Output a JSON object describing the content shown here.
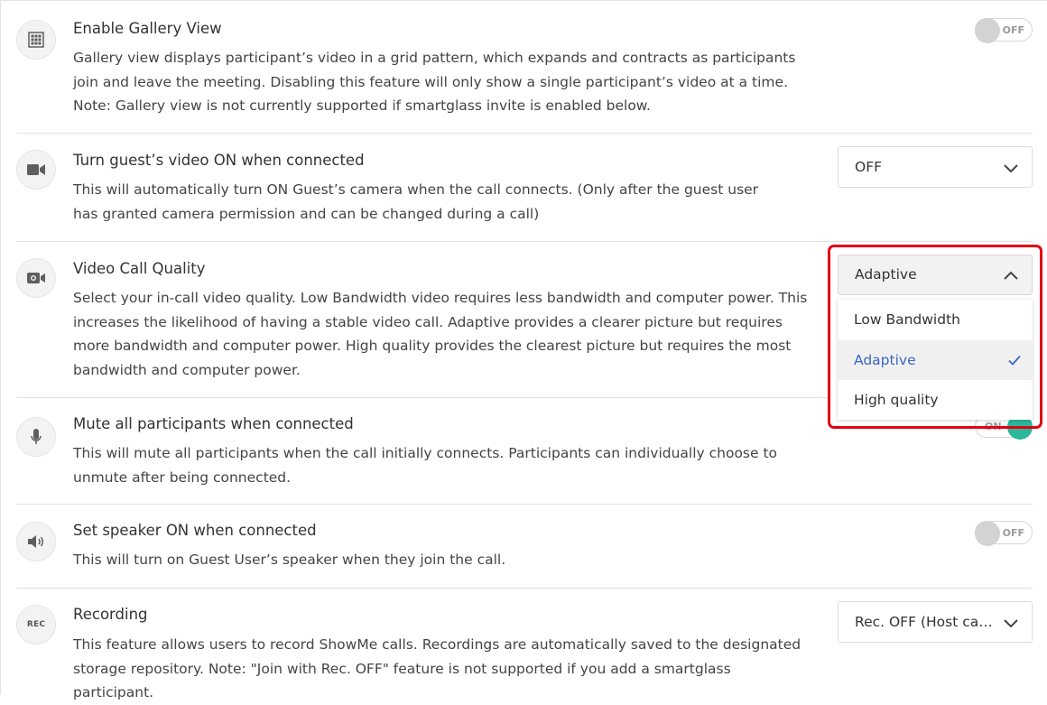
{
  "settings": [
    {
      "title": "Enable Gallery View",
      "description": "Gallery view displays participant’s video in a grid pattern, which expands and contracts as participants join and leave the meeting. Disabling this feature will only show a single participant’s video at a time. Note: Gallery view is not currently supported if smartglass invite is enabled below.",
      "icon": "grid-icon",
      "control": {
        "type": "toggle",
        "label": "OFF",
        "state": "off"
      }
    },
    {
      "title": "Turn guest’s video ON when connected",
      "description": "This will automatically turn ON Guest’s camera when the call connects. (Only after the guest user has granted camera permission and can be changed during a call)",
      "icon": "video-camera-icon",
      "control": {
        "type": "select",
        "value": "OFF"
      }
    },
    {
      "title": "Video Call Quality",
      "description": "Select your in-call video quality. Low Bandwidth video requires less bandwidth and computer power. This increases the likelihood of having a stable video call. Adaptive provides a clearer picture but requires more bandwidth and computer power. High quality provides the clearest picture but requires the most bandwidth and computer power.",
      "icon": "camera-icon",
      "control": {
        "type": "select-open",
        "value": "Adaptive",
        "options": [
          "Low Bandwidth",
          "Adaptive",
          "High quality"
        ],
        "selected": "Adaptive"
      }
    },
    {
      "title": "Mute all participants when connected",
      "description": "This will mute all participants when the call initially connects. Participants can individually choose to unmute after being connected.",
      "icon": "microphone-icon",
      "control": {
        "type": "toggle",
        "label": "ON",
        "state": "on"
      }
    },
    {
      "title": "Set speaker ON when connected",
      "description": "This will turn on Guest User’s speaker when they join the call.",
      "icon": "speaker-icon",
      "control": {
        "type": "toggle",
        "label": "OFF",
        "state": "off"
      }
    },
    {
      "title": "Recording",
      "description": "This feature allows users to record ShowMe calls. Recordings are automatically saved to the designated storage repository. Note: \"Join with Rec. OFF\" feature is not supported if you add a smartglass participant.",
      "icon": "rec-icon",
      "icon_text": "REC",
      "control": {
        "type": "select",
        "value": "Rec. OFF (Host can..."
      }
    }
  ],
  "colors": {
    "accent_on": "#2bb89a",
    "selected_text": "#3a66c4",
    "highlight_border": "#e50012"
  }
}
